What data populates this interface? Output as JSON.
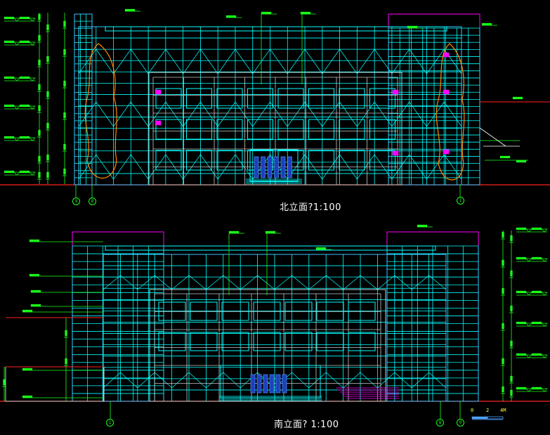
{
  "north_elevation": {
    "title": "北立面?1:100",
    "axis_labels": [
      "9",
      "8",
      "1"
    ]
  },
  "south_elevation": {
    "title": "南立面? 1:100",
    "axis_labels": [
      "1",
      "8",
      "9"
    ]
  },
  "scale_bar": {
    "labels": [
      "0",
      "2",
      "4M"
    ]
  },
  "colors": {
    "background": "#000000",
    "grid_lines": "#00ffff",
    "frame": "#ff00ff",
    "dimension": "#19ff19",
    "ground": "#ff2020",
    "tree": "#ff8800",
    "text": "#ffffff",
    "scale": "#ffff33"
  }
}
